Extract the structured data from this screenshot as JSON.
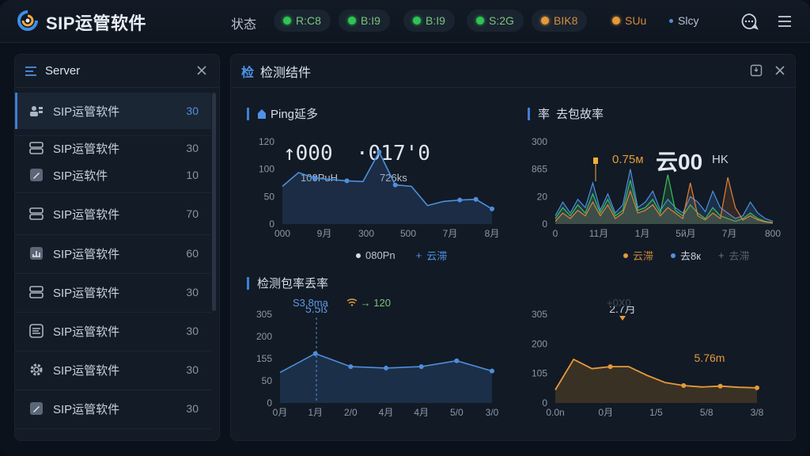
{
  "app": {
    "title": "SIP运管软件"
  },
  "header": {
    "status_label": "状态",
    "pills": [
      {
        "label": "R:C8",
        "color": "green"
      },
      {
        "label": "B:I9",
        "color": "green"
      },
      {
        "label": "B:I9",
        "color": "green"
      },
      {
        "label": "S:2G",
        "color": "green"
      },
      {
        "label": "BIK8",
        "color": "orange"
      },
      {
        "label": "SUu",
        "color": "orange"
      },
      {
        "label": "Slcy",
        "color": "plain"
      }
    ],
    "icons": [
      "chat-icon",
      "menu-icon"
    ]
  },
  "sidebar": {
    "title": "Server",
    "items": [
      {
        "label": "SIP运管软件",
        "count": "30",
        "icon": "users-icon",
        "active": true
      },
      {
        "label": "SIP运管软件",
        "count": "30",
        "icon": "server-icon"
      },
      {
        "label": "SIP运软件",
        "count": "10",
        "icon": "edit-icon"
      },
      {
        "label": "SIP运管软件",
        "count": "70",
        "icon": "server-icon"
      },
      {
        "label": "SIP运管软件",
        "count": "60",
        "icon": "chart-icon"
      },
      {
        "label": "SIP运管软件",
        "count": "30",
        "icon": "server-icon"
      },
      {
        "label": "SIP运管软件",
        "count": "30",
        "icon": "list-icon"
      },
      {
        "label": "SIP运管软件",
        "count": "30",
        "icon": "gear-icon"
      },
      {
        "label": "SIP运管软件",
        "count": "30",
        "icon": "edit-icon"
      }
    ]
  },
  "main": {
    "badge": "检",
    "title": "检测结件",
    "sections": {
      "ping": {
        "title": "Ping延多",
        "big_left": "↑000",
        "big_right": "·017'0",
        "sub_left": "100PuH",
        "sub_right": "726ks",
        "legend": [
          "080Pn",
          "云滞"
        ]
      },
      "loss": {
        "title_prefix": "率",
        "title": "去包故率",
        "label_orange": "0.75м",
        "big": "云00",
        "big_suffix": "ΗΚ",
        "legend": [
          "云滞",
          "去8к",
          "去滞"
        ]
      },
      "detect": {
        "title": "检测包率丢率",
        "sub_left": "S3.8ma",
        "sub_right": "→ 120",
        "peak_label": "5.5ß"
      },
      "orange": {
        "top_label": "+0X0",
        "peak_label": "2.7月",
        "right_label": "5.76m"
      }
    }
  },
  "colors": {
    "accent": "#3d7fd6",
    "green": "#2fc552",
    "orange": "#e59a3a",
    "background": "#0c121b"
  },
  "chart_data": [
    {
      "type": "area",
      "title": "Ping延多",
      "categories": [
        "000",
        "9月",
        "300",
        "500",
        "7月",
        "8月"
      ],
      "y_ticks": [
        "120",
        "100",
        "50",
        "0"
      ],
      "ylim": [
        0,
        120
      ],
      "series": [
        {
          "name": "云滞",
          "values": [
            55,
            75,
            67,
            65,
            63,
            62,
            105,
            57,
            55,
            27,
            33,
            35,
            36,
            22
          ]
        }
      ]
    },
    {
      "type": "line",
      "title": "去包故率",
      "categories": [
        "0",
        "11月",
        "1月",
        "5й月",
        "7月",
        "800"
      ],
      "y_ticks": [
        "300",
        "865",
        "20",
        "0"
      ],
      "ylim": [
        0,
        300
      ],
      "series": [
        {
          "name": "云滞",
          "values": [
            30,
            80,
            40,
            90,
            60,
            150,
            50,
            110,
            40,
            70,
            200,
            60,
            80,
            120,
            50,
            90,
            60,
            40,
            100,
            80,
            45,
            120,
            60,
            40,
            20,
            30,
            80,
            40,
            20,
            10
          ]
        },
        {
          "name": "去8к",
          "values": [
            20,
            60,
            30,
            70,
            40,
            110,
            40,
            90,
            30,
            50,
            160,
            50,
            60,
            90,
            40,
            180,
            50,
            30,
            70,
            40,
            20,
            60,
            30,
            20,
            10,
            20,
            40,
            20,
            10,
            5
          ]
        },
        {
          "name": "去滞",
          "values": [
            10,
            40,
            20,
            50,
            30,
            80,
            30,
            70,
            20,
            40,
            120,
            40,
            50,
            70,
            30,
            60,
            40,
            20,
            150,
            30,
            15,
            40,
            20,
            170,
            60,
            15,
            30,
            15,
            8,
            4
          ]
        }
      ]
    },
    {
      "type": "area",
      "title": "检测包率丢率",
      "categories": [
        "0月",
        "1月",
        "2/0",
        "4月",
        "4月",
        "5/0",
        "3/0"
      ],
      "y_ticks": [
        "305",
        "200",
        "155",
        "50",
        "0"
      ],
      "ylim": [
        0,
        305
      ],
      "series": [
        {
          "name": "",
          "values": [
            105,
            170,
            125,
            120,
            125,
            145,
            110
          ]
        }
      ]
    },
    {
      "type": "area",
      "title": "",
      "categories": [
        "0.0n",
        "0月",
        "1/5",
        "5/8",
        "3/8"
      ],
      "y_ticks": [
        "305",
        "200",
        "105",
        "0"
      ],
      "ylim": [
        0,
        305
      ],
      "series": [
        {
          "name": "",
          "values": [
            45,
            150,
            118,
            125,
            125,
            95,
            70,
            60,
            55,
            58,
            54,
            52
          ]
        }
      ]
    }
  ]
}
